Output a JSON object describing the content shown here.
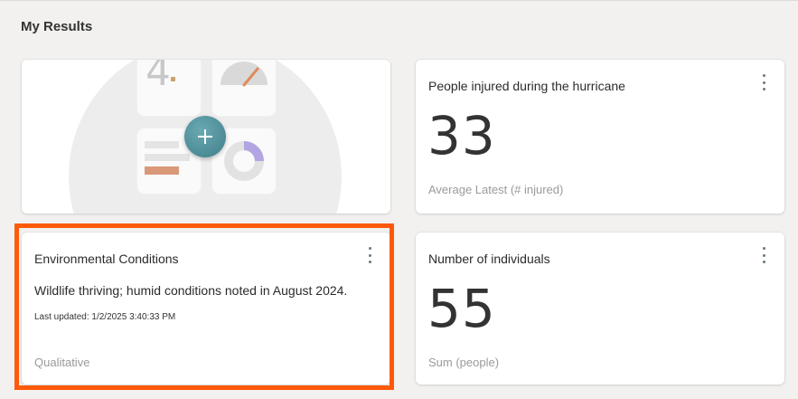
{
  "page": {
    "title": "My Results"
  },
  "add_card": {
    "illustration": {
      "number": "4",
      "icon": "plus-icon",
      "accent": "#4f8d97"
    }
  },
  "cards": {
    "injured": {
      "title": "People injured during the hurricane",
      "value": "33",
      "caption": "Average Latest (# injured)",
      "menu_icon": "kebab-menu-icon"
    },
    "individuals": {
      "title": "Number of individuals",
      "value": "55",
      "caption": "Sum (people)",
      "menu_icon": "kebab-menu-icon"
    },
    "environmental": {
      "title": "Environmental Conditions",
      "body": "Wildlife thriving; humid conditions noted in August 2024.",
      "updated": "Last updated: 1/2/2025 3:40:33 PM",
      "caption": "Qualitative",
      "menu_icon": "kebab-menu-icon"
    }
  },
  "colors": {
    "highlight": "#ff5a0a",
    "background": "#f2f1ef"
  }
}
